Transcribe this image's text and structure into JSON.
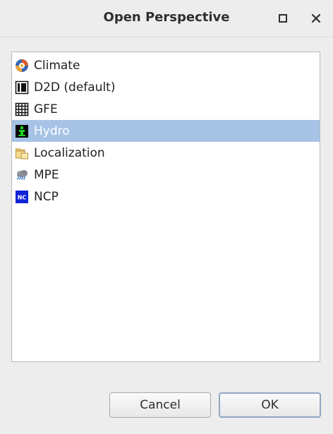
{
  "window": {
    "title": "Open Perspective"
  },
  "perspectives": {
    "items": [
      {
        "label": "Climate",
        "icon": "climate-icon",
        "selected": false
      },
      {
        "label": "D2D (default)",
        "icon": "d2d-icon",
        "selected": false
      },
      {
        "label": "GFE",
        "icon": "gfe-grid-icon",
        "selected": false
      },
      {
        "label": "Hydro",
        "icon": "hydro-icon",
        "selected": true
      },
      {
        "label": "Localization",
        "icon": "localization-folder-icon",
        "selected": false
      },
      {
        "label": "MPE",
        "icon": "mpe-cloud-icon",
        "selected": false
      },
      {
        "label": "NCP",
        "icon": "ncp-icon",
        "selected": false
      }
    ],
    "selected_color": "#a6c3e6"
  },
  "buttons": {
    "cancel_label": "Cancel",
    "ok_label": "OK"
  },
  "icons": {
    "ncp_text": "NC"
  }
}
